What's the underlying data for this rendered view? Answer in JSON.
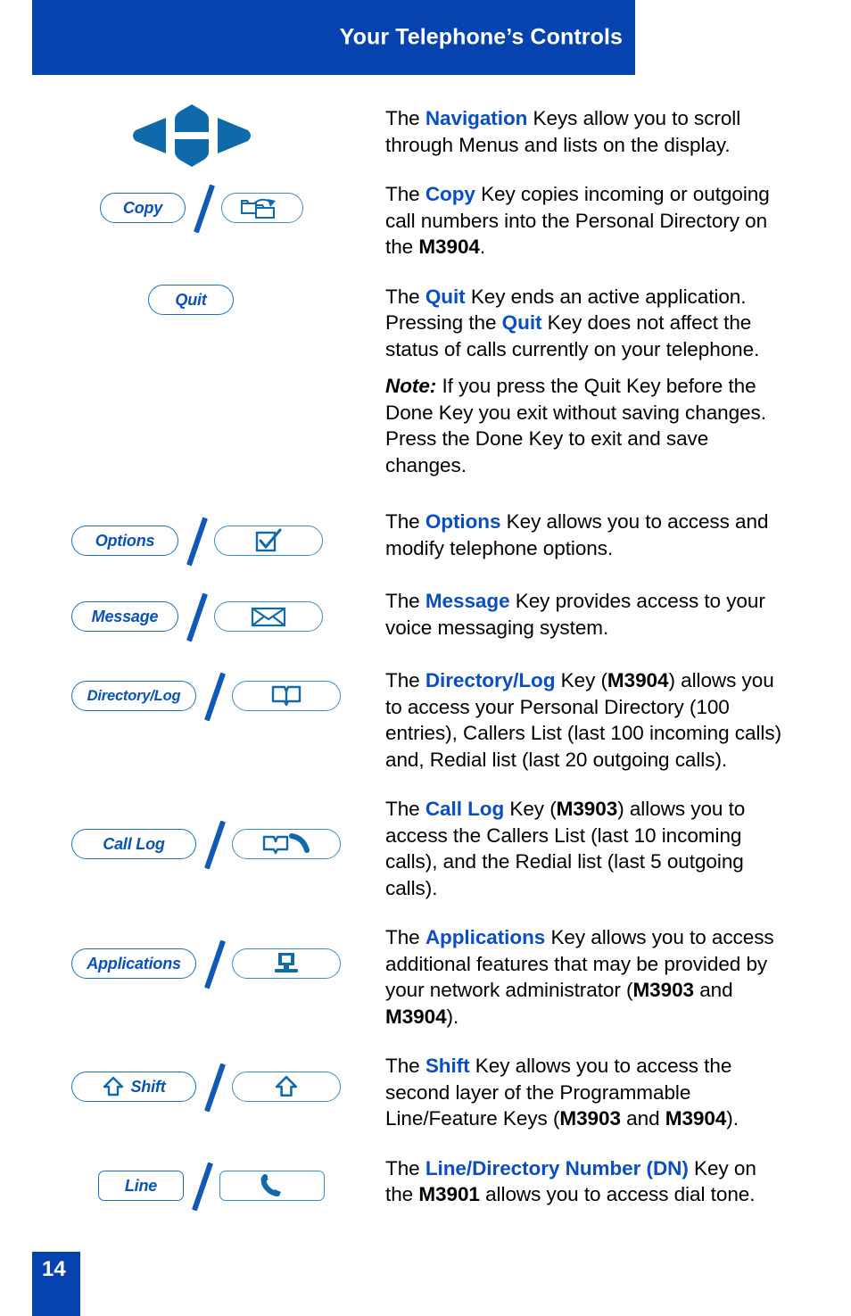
{
  "header": {
    "title": "Your Telephone’s Controls"
  },
  "footer": {
    "page_number": "14"
  },
  "colors": {
    "header_blue": "#0743ae",
    "keyword_blue": "#0a4ec2",
    "key_outline_blue": "#1b72b8",
    "icon_blue": "#1069a8",
    "slash_blue": "#1158b8"
  },
  "keys": {
    "navigation": {
      "name": "navigation-keys",
      "icon": "four-way-navigation-pad-icon"
    },
    "copy": {
      "label": "Copy",
      "icon": "copy-folders-arrow-icon"
    },
    "quit": {
      "label": "Quit"
    },
    "options": {
      "label": "Options",
      "icon": "checkbox-check-icon"
    },
    "message": {
      "label": "Message",
      "icon": "envelope-icon"
    },
    "directory_log": {
      "label": "Directory/Log",
      "icon": "open-book-icon"
    },
    "call_log": {
      "label": "Call Log",
      "icon": "open-book-handset-icon"
    },
    "applications": {
      "label": "Applications",
      "icon": "computer-monitor-icon"
    },
    "shift": {
      "label": "Shift",
      "icon": "up-arrow-outline-icon"
    },
    "line": {
      "label": "Line",
      "icon": "telephone-handset-icon"
    }
  },
  "paragraphs": {
    "navigation": {
      "p1": "The ",
      "kw": "Navigation",
      "p2": " Keys allow you to scroll through Menus and lists on the display."
    },
    "copy": {
      "p1": "The ",
      "kw": "Copy",
      "p2": " Key copies incoming or outgoing call numbers into the Personal Directory on the ",
      "model": "M3904",
      "p3": "."
    },
    "quit": {
      "p1": "The ",
      "kw1": "Quit",
      "p2": " Key ends an active application. Pressing the ",
      "kw2": "Quit",
      "p3": " Key does not affect the status of calls currently on your telephone."
    },
    "note": {
      "lead": "Note:",
      "text": " If you press the Quit Key before the Done Key you exit without saving changes. Press the Done Key to exit and save changes."
    },
    "options": {
      "p1": "The ",
      "kw": "Options",
      "p2": " Key allows you to access and modify telephone options."
    },
    "message": {
      "p1": "The ",
      "kw": "Message",
      "p2": " Key provides access to your voice messaging system."
    },
    "directory_log": {
      "p1": "The ",
      "kw": "Directory/Log",
      "p2": " Key (",
      "model": "M3904",
      "p3": ") allows you to access your Personal Directory (100 entries), Callers List (last 100 incoming calls) and, Redial list (last 20 outgoing calls)."
    },
    "call_log": {
      "p1": "The ",
      "kw": "Call Log",
      "p2": " Key (",
      "model": "M3903",
      "p3": ") allows you to access the Callers List (last 10 incoming calls), and the Redial list (last 5 outgoing calls)."
    },
    "applications": {
      "p1": "The ",
      "kw": "Applications",
      "p2": " Key allows you to access additional features that may be provided by your network administrator (",
      "model1": "M3903",
      "p3": " and ",
      "model2": "M3904",
      "p4": ")."
    },
    "shift": {
      "p1": "The ",
      "kw": "Shift",
      "p2": " Key allows you to access the second layer of the Programmable Line/Feature Keys (",
      "model1": "M3903",
      "p3": " and ",
      "model2": "M3904",
      "p4": ")."
    },
    "line_dn": {
      "p1": "The ",
      "kw": "Line/Directory Number (DN)",
      "p2": " Key on the ",
      "model": "M3901",
      "p3": " allows you to access dial tone."
    }
  }
}
